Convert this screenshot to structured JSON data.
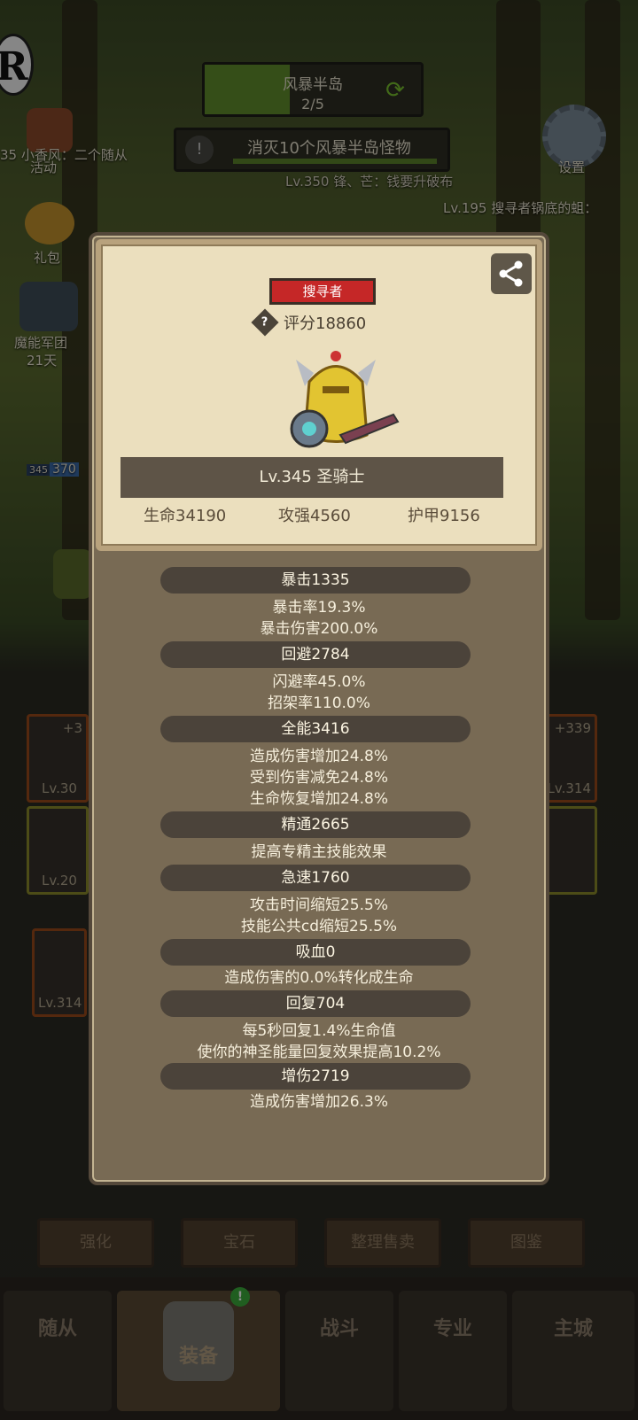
{
  "background": {
    "stage": {
      "name": "风暴半岛",
      "progress": "2/5"
    },
    "quest": {
      "text": "消灭10个风暴半岛怪物"
    },
    "left_menu": [
      {
        "label": "活动",
        "icon": "event-board-icon"
      },
      {
        "label": "礼包",
        "icon": "gift-coin-icon"
      },
      {
        "label": "魔能军团",
        "icon": "skull-helmet-icon"
      },
      {
        "label": "21天",
        "icon": ""
      }
    ],
    "scroll_texts": [
      "35 小香风：二个随从",
      "Lv.350 锋、芒：钱要升破布",
      "Lv.195 搜寻者锅底的蛆："
    ],
    "settings_label": "设置",
    "hero_level_tag": "345",
    "hero_hp_tag": "370",
    "equip_slots": [
      "+3",
      "Lv.30",
      "Lv.20",
      "Lv.314",
      "+339",
      "Lv.314"
    ],
    "action_buttons": [
      "强化",
      "宝石",
      "整理售卖",
      "图鉴"
    ],
    "tabs": [
      "随从",
      "装备",
      "战斗",
      "专业",
      "主城"
    ],
    "tab_badge": "!"
  },
  "dialog": {
    "class_badge": "搜寻者",
    "score_label": "评分18860",
    "score_help": "?",
    "name": "Lv.345 圣骑士",
    "stats": {
      "hp": "生命34190",
      "atk": "攻强4560",
      "armor": "护甲9156"
    },
    "sections": [
      {
        "title": "暴击1335",
        "lines": [
          "暴击率19.3%",
          "暴击伤害200.0%"
        ]
      },
      {
        "title": "回避2784",
        "lines": [
          "闪避率45.0%",
          "招架率110.0%"
        ]
      },
      {
        "title": "全能3416",
        "lines": [
          "造成伤害增加24.8%",
          "受到伤害减免24.8%",
          "生命恢复增加24.8%"
        ]
      },
      {
        "title": "精通2665",
        "lines": [
          "提高专精主技能效果"
        ]
      },
      {
        "title": "急速1760",
        "lines": [
          "攻击时间缩短25.5%",
          "技能公共cd缩短25.5%"
        ]
      },
      {
        "title": "吸血0",
        "lines": [
          "造成伤害的0.0%转化成生命"
        ]
      },
      {
        "title": "回复704",
        "lines": [
          "每5秒回复1.4%生命值",
          "使你的神圣能量回复效果提高10.2%"
        ]
      },
      {
        "title": "增伤2719",
        "lines": [
          "造成伤害增加26.3%"
        ]
      }
    ],
    "colors": {
      "badge": "#c52727",
      "parchment": "#ebdfbe",
      "panel": "#786a54",
      "section_bar": "#4b433a"
    }
  }
}
